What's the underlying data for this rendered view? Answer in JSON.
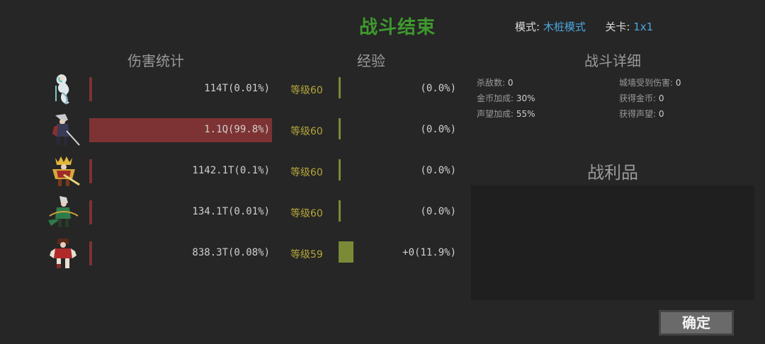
{
  "header": {
    "title": "战斗结束",
    "mode_label": "模式:",
    "mode_value": "木桩模式",
    "stage_label": "关卡:",
    "stage_value": "1x1"
  },
  "sections": {
    "damage": "伤害统计",
    "exp": "经验",
    "detail": "战斗详细",
    "loot": "战利品"
  },
  "heroes": [
    {
      "portrait": "white-serpent-hero-icon",
      "damage": "114T(0.01%)",
      "damage_share": 0.0001,
      "level": "等级60",
      "exp": "(0.0%)",
      "exp_share": 0.0
    },
    {
      "portrait": "silver-swordsman-hero-icon",
      "damage": "1.1Q(99.8%)",
      "damage_share": 0.998,
      "level": "等级60",
      "exp": "(0.0%)",
      "exp_share": 0.0
    },
    {
      "portrait": "golden-king-hero-icon",
      "damage": "1142.1T(0.1%)",
      "damage_share": 0.001,
      "level": "等级60",
      "exp": "(0.0%)",
      "exp_share": 0.0
    },
    {
      "portrait": "green-archer-hero-icon",
      "damage": "134.1T(0.01%)",
      "damage_share": 0.0001,
      "level": "等级60",
      "exp": "(0.0%)",
      "exp_share": 0.0
    },
    {
      "portrait": "red-warrior-hero-icon",
      "damage": "838.3T(0.08%)",
      "damage_share": 0.0008,
      "level": "等级59",
      "exp": "+0(11.9%)",
      "exp_share": 0.119
    }
  ],
  "details": {
    "kills_label": "杀敌数:",
    "kills": "0",
    "wall_dmg_label": "城墙受到伤害:",
    "wall_dmg": "0",
    "gold_bonus_label": "金币加成:",
    "gold_bonus": "30%",
    "gold_gain_label": "获得金币:",
    "gold_gain": "0",
    "rep_bonus_label": "声望加成:",
    "rep_bonus": "55%",
    "rep_gain_label": "获得声望:",
    "rep_gain": "0"
  },
  "confirm_label": "确定",
  "colors": {
    "background": "#262626",
    "title": "#3e9a2e",
    "damage_bar": "#7d3333",
    "exp_bar": "#7a8a36",
    "level_text": "#b4a63a",
    "accent_blue": "#4aa6e0"
  }
}
